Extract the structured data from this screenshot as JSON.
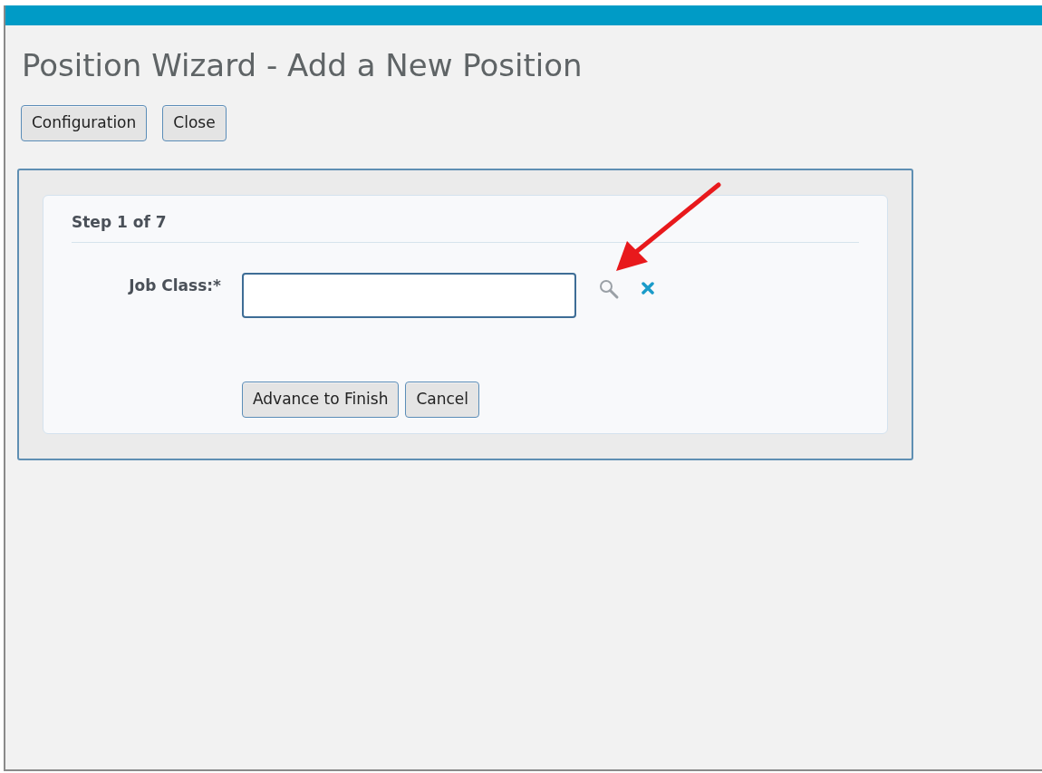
{
  "page": {
    "title": "Position Wizard - Add a New Position"
  },
  "toolbar": [
    "Configuration",
    "Close"
  ],
  "wizard": {
    "step": "Step 1 of 7",
    "field": {
      "label": "Job Class:*"
    },
    "buttons": [
      "Advance to Finish",
      "Cancel"
    ]
  },
  "annotation": {
    "kind": "arrow",
    "color": "#e8191c"
  }
}
